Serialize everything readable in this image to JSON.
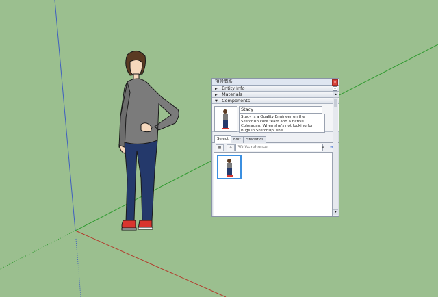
{
  "tray": {
    "title": "預設面板",
    "sections": [
      {
        "label": "Entity Info",
        "arrow": "►"
      },
      {
        "label": "Materials",
        "arrow": "►"
      },
      {
        "label": "Components",
        "arrow": "▼"
      }
    ],
    "component": {
      "name": "Stacy",
      "description": "Stacy is a Quality Engineer on the SketchUp core team and a native Coloradan. When she's not looking for bugs in SketchUp, she"
    },
    "tabs": [
      "Select",
      "Edit",
      "Statistics"
    ],
    "search_placeholder": "3D Warehouse"
  },
  "icons": {
    "close": "close-icon",
    "search": "search-icon",
    "go": "arrow-right-icon"
  },
  "colors": {
    "background": "#9bbf8f",
    "axis_red": "#b3392b",
    "axis_green": "#2f9a2f",
    "axis_blue": "#3f5fc0"
  }
}
